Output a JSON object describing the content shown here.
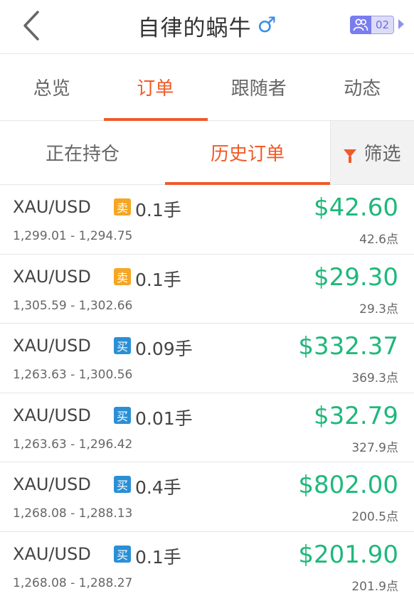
{
  "header": {
    "title": "自律的蜗牛",
    "gender_symbol": "♂",
    "group_count": "02"
  },
  "tabs": [
    {
      "label": "总览",
      "active": false
    },
    {
      "label": "订单",
      "active": true
    },
    {
      "label": "跟随者",
      "active": false
    },
    {
      "label": "动态",
      "active": false
    }
  ],
  "subtabs": [
    {
      "label": "正在持仓",
      "active": false
    },
    {
      "label": "历史订单",
      "active": true
    }
  ],
  "filter": {
    "label": "筛选"
  },
  "orders": [
    {
      "symbol": "XAU/USD",
      "side": "卖",
      "side_type": "sell",
      "lots": "0.1手",
      "range": "1,299.01 - 1,294.75",
      "profit": "$42.60",
      "points": "42.6点"
    },
    {
      "symbol": "XAU/USD",
      "side": "卖",
      "side_type": "sell",
      "lots": "0.1手",
      "range": "1,305.59 - 1,302.66",
      "profit": "$29.30",
      "points": "29.3点"
    },
    {
      "symbol": "XAU/USD",
      "side": "买",
      "side_type": "buy",
      "lots": "0.09手",
      "range": "1,263.63 - 1,300.56",
      "profit": "$332.37",
      "points": "369.3点"
    },
    {
      "symbol": "XAU/USD",
      "side": "买",
      "side_type": "buy",
      "lots": "0.01手",
      "range": "1,263.63 - 1,296.42",
      "profit": "$32.79",
      "points": "327.9点"
    },
    {
      "symbol": "XAU/USD",
      "side": "买",
      "side_type": "buy",
      "lots": "0.4手",
      "range": "1,268.08 - 1,288.13",
      "profit": "$802.00",
      "points": "200.5点"
    },
    {
      "symbol": "XAU/USD",
      "side": "买",
      "side_type": "buy",
      "lots": "0.1手",
      "range": "1,268.08 - 1,288.27",
      "profit": "$201.90",
      "points": "201.9点"
    }
  ],
  "colors": {
    "accent": "#f05a28",
    "profit": "#1fb87a",
    "sell_badge": "#f5a623",
    "buy_badge": "#2b8fd6"
  }
}
